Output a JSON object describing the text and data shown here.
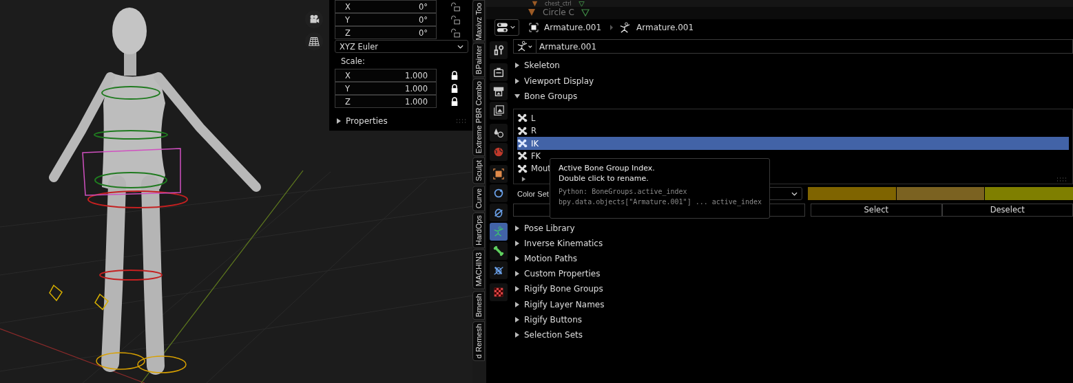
{
  "outliner": {
    "rows": [
      {
        "label": "chest_ctrl"
      },
      {
        "label": "Circle C"
      }
    ]
  },
  "transform_panel": {
    "rotation": [
      {
        "axis": "X",
        "value": "0°",
        "locked": false
      },
      {
        "axis": "Y",
        "value": "0°",
        "locked": false
      },
      {
        "axis": "Z",
        "value": "0°",
        "locked": false
      }
    ],
    "rotation_mode": "XYZ Euler",
    "scale_label": "Scale:",
    "scale": [
      {
        "axis": "X",
        "value": "1.000",
        "locked": true
      },
      {
        "axis": "Y",
        "value": "1.000",
        "locked": true
      },
      {
        "axis": "Z",
        "value": "1.000",
        "locked": true
      }
    ],
    "subpanel": {
      "label": "Properties",
      "expanded": false
    }
  },
  "sidebar_tabs": [
    "Maxivz Too",
    "BPainter",
    "Extreme PBR Combo",
    "Sculpt",
    "Curve",
    "HardOps",
    "MACHIN3",
    "Bmesh",
    "d Remesh"
  ],
  "properties": {
    "header": {
      "object": "Armature.001",
      "data": "Armature.001"
    },
    "data_field": "Armature.001",
    "editor_tabs": [
      {
        "kind": "tool",
        "selected": false
      },
      {
        "kind": "render",
        "selected": false
      },
      {
        "kind": "output",
        "selected": false
      },
      {
        "kind": "view_layer",
        "selected": false
      },
      {
        "kind": "scene",
        "selected": false
      },
      {
        "kind": "world",
        "selected": false
      },
      {
        "kind": "object",
        "selected": false
      },
      {
        "kind": "physics",
        "selected": false
      },
      {
        "kind": "constraints",
        "selected": false
      },
      {
        "kind": "data",
        "selected": true
      },
      {
        "kind": "bone",
        "selected": false
      },
      {
        "kind": "bone_constraint",
        "selected": false
      },
      {
        "kind": "texture",
        "selected": false
      }
    ],
    "panels_before": [
      {
        "label": "Skeleton",
        "expanded": false
      },
      {
        "label": "Viewport Display",
        "expanded": false
      },
      {
        "label": "Bone Groups",
        "expanded": true
      }
    ],
    "bone_groups": {
      "items": [
        {
          "label": "L",
          "selected": false
        },
        {
          "label": "R",
          "selected": false
        },
        {
          "label": "IK",
          "selected": true
        },
        {
          "label": "FK",
          "selected": false
        },
        {
          "label": "Mout",
          "selected": false
        }
      ],
      "color_set_label": "Color Set",
      "colors": [
        {
          "color": "#7f6400"
        },
        {
          "color": "#7b6221"
        },
        {
          "color": "#7f7f00"
        }
      ],
      "buttons": [
        "Select",
        "Deselect"
      ]
    },
    "panels_after": [
      {
        "label": "Pose Library",
        "expanded": false
      },
      {
        "label": "Inverse Kinematics",
        "expanded": false
      },
      {
        "label": "Motion Paths",
        "expanded": false
      },
      {
        "label": "Custom Properties",
        "expanded": false
      },
      {
        "label": "Rigify Bone Groups",
        "expanded": false
      },
      {
        "label": "Rigify Layer Names",
        "expanded": false
      },
      {
        "label": "Rigify Buttons",
        "expanded": false
      },
      {
        "label": "Selection Sets",
        "expanded": false
      }
    ]
  },
  "tooltip": {
    "lines": [
      "Active Bone Group Index.",
      "Double click to rename."
    ],
    "python_lines": [
      "Python: BoneGroups.active_index",
      "bpy.data.objects[\"Armature.001\"] ... active_index"
    ]
  }
}
